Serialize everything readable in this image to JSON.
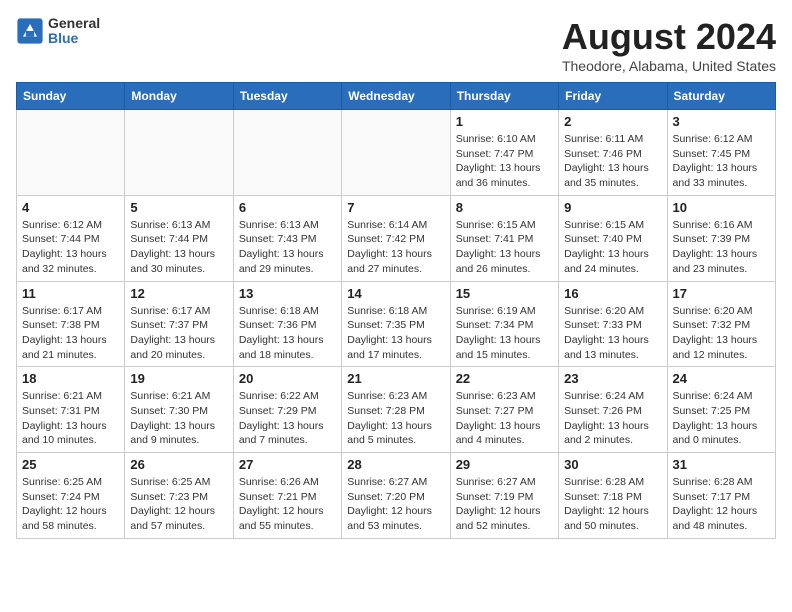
{
  "logo": {
    "general": "General",
    "blue": "Blue"
  },
  "title": "August 2024",
  "location": "Theodore, Alabama, United States",
  "weekdays": [
    "Sunday",
    "Monday",
    "Tuesday",
    "Wednesday",
    "Thursday",
    "Friday",
    "Saturday"
  ],
  "weeks": [
    [
      {
        "day": "",
        "info": ""
      },
      {
        "day": "",
        "info": ""
      },
      {
        "day": "",
        "info": ""
      },
      {
        "day": "",
        "info": ""
      },
      {
        "day": "1",
        "info": "Sunrise: 6:10 AM\nSunset: 7:47 PM\nDaylight: 13 hours\nand 36 minutes."
      },
      {
        "day": "2",
        "info": "Sunrise: 6:11 AM\nSunset: 7:46 PM\nDaylight: 13 hours\nand 35 minutes."
      },
      {
        "day": "3",
        "info": "Sunrise: 6:12 AM\nSunset: 7:45 PM\nDaylight: 13 hours\nand 33 minutes."
      }
    ],
    [
      {
        "day": "4",
        "info": "Sunrise: 6:12 AM\nSunset: 7:44 PM\nDaylight: 13 hours\nand 32 minutes."
      },
      {
        "day": "5",
        "info": "Sunrise: 6:13 AM\nSunset: 7:44 PM\nDaylight: 13 hours\nand 30 minutes."
      },
      {
        "day": "6",
        "info": "Sunrise: 6:13 AM\nSunset: 7:43 PM\nDaylight: 13 hours\nand 29 minutes."
      },
      {
        "day": "7",
        "info": "Sunrise: 6:14 AM\nSunset: 7:42 PM\nDaylight: 13 hours\nand 27 minutes."
      },
      {
        "day": "8",
        "info": "Sunrise: 6:15 AM\nSunset: 7:41 PM\nDaylight: 13 hours\nand 26 minutes."
      },
      {
        "day": "9",
        "info": "Sunrise: 6:15 AM\nSunset: 7:40 PM\nDaylight: 13 hours\nand 24 minutes."
      },
      {
        "day": "10",
        "info": "Sunrise: 6:16 AM\nSunset: 7:39 PM\nDaylight: 13 hours\nand 23 minutes."
      }
    ],
    [
      {
        "day": "11",
        "info": "Sunrise: 6:17 AM\nSunset: 7:38 PM\nDaylight: 13 hours\nand 21 minutes."
      },
      {
        "day": "12",
        "info": "Sunrise: 6:17 AM\nSunset: 7:37 PM\nDaylight: 13 hours\nand 20 minutes."
      },
      {
        "day": "13",
        "info": "Sunrise: 6:18 AM\nSunset: 7:36 PM\nDaylight: 13 hours\nand 18 minutes."
      },
      {
        "day": "14",
        "info": "Sunrise: 6:18 AM\nSunset: 7:35 PM\nDaylight: 13 hours\nand 17 minutes."
      },
      {
        "day": "15",
        "info": "Sunrise: 6:19 AM\nSunset: 7:34 PM\nDaylight: 13 hours\nand 15 minutes."
      },
      {
        "day": "16",
        "info": "Sunrise: 6:20 AM\nSunset: 7:33 PM\nDaylight: 13 hours\nand 13 minutes."
      },
      {
        "day": "17",
        "info": "Sunrise: 6:20 AM\nSunset: 7:32 PM\nDaylight: 13 hours\nand 12 minutes."
      }
    ],
    [
      {
        "day": "18",
        "info": "Sunrise: 6:21 AM\nSunset: 7:31 PM\nDaylight: 13 hours\nand 10 minutes."
      },
      {
        "day": "19",
        "info": "Sunrise: 6:21 AM\nSunset: 7:30 PM\nDaylight: 13 hours\nand 9 minutes."
      },
      {
        "day": "20",
        "info": "Sunrise: 6:22 AM\nSunset: 7:29 PM\nDaylight: 13 hours\nand 7 minutes."
      },
      {
        "day": "21",
        "info": "Sunrise: 6:23 AM\nSunset: 7:28 PM\nDaylight: 13 hours\nand 5 minutes."
      },
      {
        "day": "22",
        "info": "Sunrise: 6:23 AM\nSunset: 7:27 PM\nDaylight: 13 hours\nand 4 minutes."
      },
      {
        "day": "23",
        "info": "Sunrise: 6:24 AM\nSunset: 7:26 PM\nDaylight: 13 hours\nand 2 minutes."
      },
      {
        "day": "24",
        "info": "Sunrise: 6:24 AM\nSunset: 7:25 PM\nDaylight: 13 hours\nand 0 minutes."
      }
    ],
    [
      {
        "day": "25",
        "info": "Sunrise: 6:25 AM\nSunset: 7:24 PM\nDaylight: 12 hours\nand 58 minutes."
      },
      {
        "day": "26",
        "info": "Sunrise: 6:25 AM\nSunset: 7:23 PM\nDaylight: 12 hours\nand 57 minutes."
      },
      {
        "day": "27",
        "info": "Sunrise: 6:26 AM\nSunset: 7:21 PM\nDaylight: 12 hours\nand 55 minutes."
      },
      {
        "day": "28",
        "info": "Sunrise: 6:27 AM\nSunset: 7:20 PM\nDaylight: 12 hours\nand 53 minutes."
      },
      {
        "day": "29",
        "info": "Sunrise: 6:27 AM\nSunset: 7:19 PM\nDaylight: 12 hours\nand 52 minutes."
      },
      {
        "day": "30",
        "info": "Sunrise: 6:28 AM\nSunset: 7:18 PM\nDaylight: 12 hours\nand 50 minutes."
      },
      {
        "day": "31",
        "info": "Sunrise: 6:28 AM\nSunset: 7:17 PM\nDaylight: 12 hours\nand 48 minutes."
      }
    ]
  ]
}
